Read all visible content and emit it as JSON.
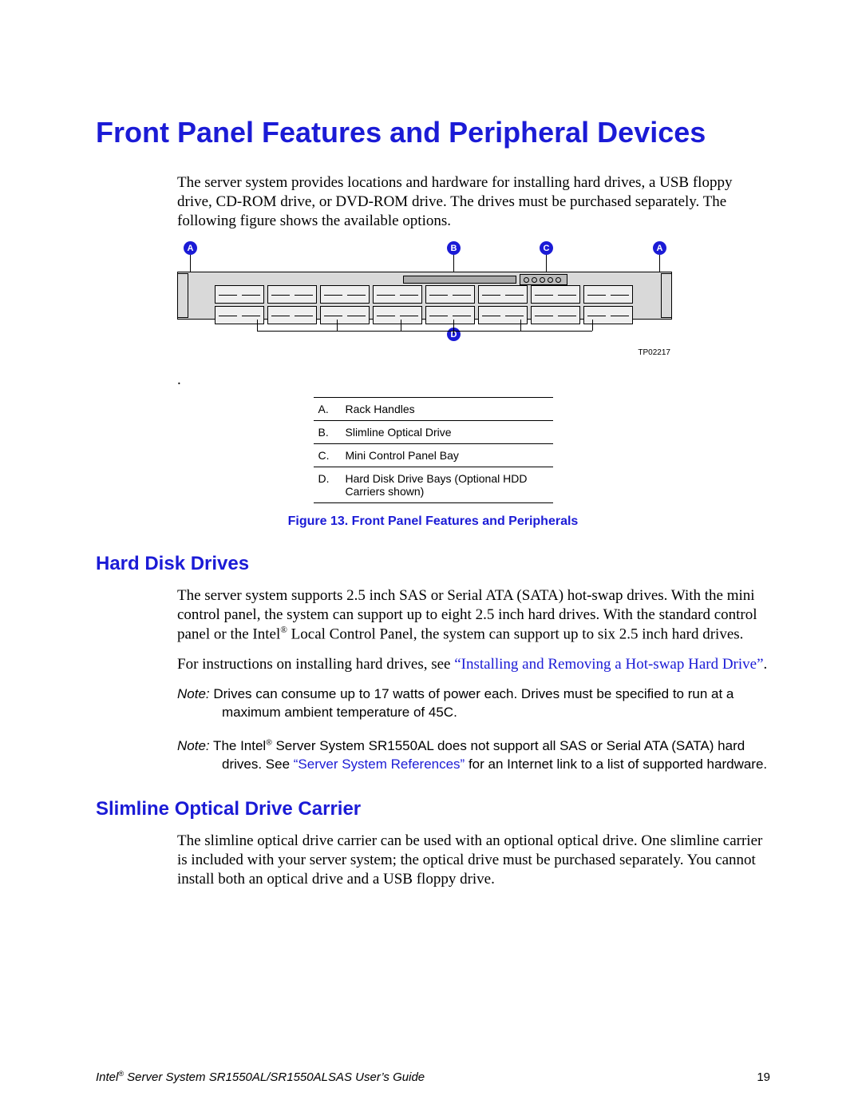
{
  "headings": {
    "h1": "Front Panel Features and Peripheral Devices",
    "h2a": "Hard Disk Drives",
    "h2b": "Slimline Optical Drive Carrier"
  },
  "intro": "The server system provides locations and hardware for installing hard drives, a USB floppy drive, CD-ROM drive, or DVD-ROM drive. The drives must be purchased separately. The following figure shows the available options.",
  "figure": {
    "id": "TP02217",
    "callouts": {
      "A": "A",
      "B": "B",
      "C": "C",
      "D": "D"
    },
    "caption": "Figure 13. Front Panel Features and Peripherals",
    "legend": [
      {
        "letter": "A.",
        "text": "Rack Handles"
      },
      {
        "letter": "B.",
        "text": "Slimline Optical Drive"
      },
      {
        "letter": "C.",
        "text": "Mini Control Panel Bay"
      },
      {
        "letter": "D.",
        "text": "Hard Disk Drive Bays (Optional HDD Carriers shown)"
      }
    ]
  },
  "hdd": {
    "p1a": "The server system supports 2.5 inch SAS or Serial ATA (SATA) hot-swap drives. With the mini control panel, the system can support up to eight 2.5 inch hard drives. With the standard control panel or the Intel",
    "p1b": " Local Control Panel, the system can support up to six 2.5 inch hard drives.",
    "p2a": "For instructions on installing hard drives, see ",
    "p2link": "“Installing and Removing a Hot-swap Hard Drive”",
    "p2b": "."
  },
  "notes": {
    "label": "Note:",
    "n1a": " Drives can consume up to 17 watts of power ",
    "n1b": "each",
    "n1c": ". Drives must be ",
    "n1d": "specified to run at a maximum ambient temperature of 45C.",
    "n2a": " The Intel",
    "n2b": " Server System SR1550AL does not support ",
    "n2c": "all",
    "n2d": " SAS or Serial ATA (SATA) hard drives. See ",
    "n2link": "“Server System References”",
    "n2e": " for an Internet link to a list of supported hardware."
  },
  "optical": {
    "p1": "The slimline optical drive carrier can be used with an optional optical drive. One slimline carrier is included with your server system; the optical drive must be purchased separately. You cannot install both an optical drive and a USB floppy drive."
  },
  "footer": {
    "title_a": "Intel",
    "title_b": " Server System SR1550AL/SR1550ALSAS User’s Guide",
    "page": "19"
  },
  "reg": "®"
}
